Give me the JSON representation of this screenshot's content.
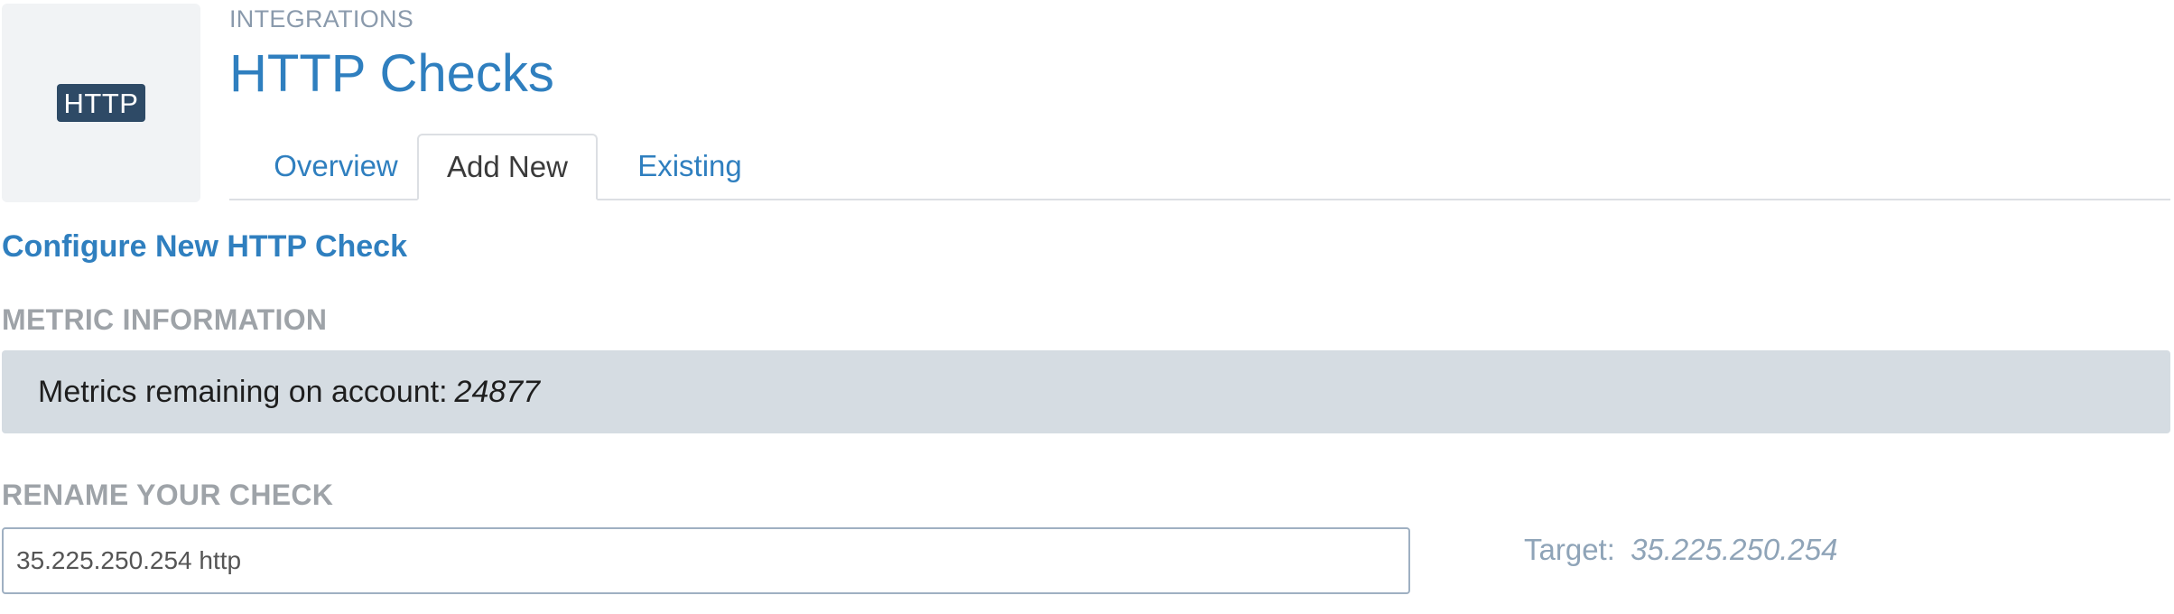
{
  "header": {
    "logo_text": "HTTP",
    "breadcrumb": "INTEGRATIONS",
    "title": "HTTP Checks"
  },
  "tabs": [
    {
      "label": "Overview",
      "active": false
    },
    {
      "label": "Add New",
      "active": true
    },
    {
      "label": "Existing",
      "active": false
    }
  ],
  "form": {
    "section_title": "Configure New HTTP Check",
    "metric_heading": "METRIC INFORMATION",
    "metrics_label": "Metrics remaining on account:",
    "metrics_value": "24877",
    "rename_heading": "RENAME YOUR CHECK",
    "check_name_value": "35.225.250.254 http",
    "target_label": "Target:",
    "target_value": "35.225.250.254"
  },
  "colors": {
    "accent": "#2f7fbf",
    "logo_bg": "#2e4a66",
    "metric_box_bg": "#d5dce2",
    "heading_gray": "#9ea3a8"
  }
}
